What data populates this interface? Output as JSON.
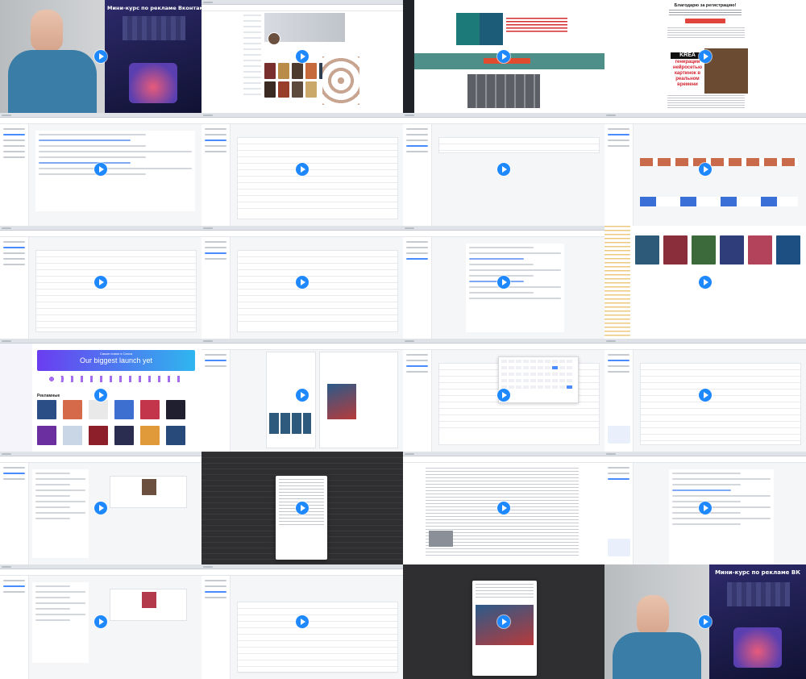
{
  "grid": {
    "columns": 4,
    "rows": 6
  },
  "cells": [
    {
      "id": 1,
      "kind": "webcam"
    },
    {
      "id": 2,
      "kind": "webpage-profile"
    },
    {
      "id": 3,
      "kind": "webpage-landing"
    },
    {
      "id": 4,
      "kind": "webpage-registration",
      "heading": "Благодарю за регистрацию!",
      "banner_title": "KREA",
      "banner_text": "генерации нейросетью картинок в реальном времени"
    },
    {
      "id": 5,
      "kind": "app-settings"
    },
    {
      "id": 6,
      "kind": "app-table"
    },
    {
      "id": 7,
      "kind": "app-list"
    },
    {
      "id": 8,
      "kind": "app-dashboard"
    },
    {
      "id": 9,
      "kind": "app-table"
    },
    {
      "id": 10,
      "kind": "app-table"
    },
    {
      "id": 11,
      "kind": "app-form"
    },
    {
      "id": 12,
      "kind": "image-gallery"
    },
    {
      "id": 13,
      "kind": "canva",
      "hero_small": "Самое новое в Canva",
      "hero_title": "Our biggest launch yet",
      "section_title": "Рекламные"
    },
    {
      "id": 14,
      "kind": "app-editor"
    },
    {
      "id": 15,
      "kind": "app-calendar"
    },
    {
      "id": 16,
      "kind": "app-table"
    },
    {
      "id": 17,
      "kind": "app-product"
    },
    {
      "id": 18,
      "kind": "app-modal-dark"
    },
    {
      "id": 19,
      "kind": "app-document"
    },
    {
      "id": 20,
      "kind": "app-form"
    },
    {
      "id": 21,
      "kind": "app-product"
    },
    {
      "id": 22,
      "kind": "app-table"
    },
    {
      "id": 23,
      "kind": "app-modal-dark"
    },
    {
      "id": 24,
      "kind": "webcam"
    }
  ],
  "labels": {
    "poster_title": "Мини-курс по рекламе Вконтакте",
    "poster_title_end": "Мини-курс по рекламе ВК",
    "play": "▶"
  },
  "colors": {
    "accent": "#1e88ff",
    "teal": "#4e8f8a",
    "dark": "#2f2f31",
    "poster": "#1a1b4a"
  }
}
